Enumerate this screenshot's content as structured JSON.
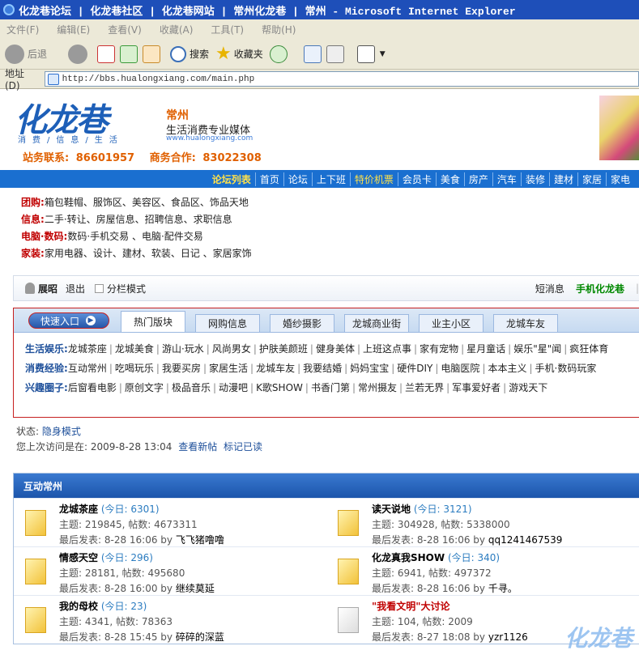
{
  "window": {
    "title": "化龙巷论坛 | 化龙巷社区 | 化龙巷网站 | 常州化龙巷 | 常州 - Microsoft Internet Explorer"
  },
  "menubar": [
    "文件(F)",
    "编辑(E)",
    "查看(V)",
    "收藏(A)",
    "工具(T)",
    "帮助(H)"
  ],
  "toolbar": {
    "back": "后退",
    "search": "搜索",
    "favorites": "收藏夹"
  },
  "address": {
    "label": "地址(D)",
    "url": "http://bbs.hualongxiang.com/main.php"
  },
  "header": {
    "logo": "化龙巷",
    "logo_sub": "消费/信息/生活",
    "city": "常州",
    "slogan": "生活消费专业媒体",
    "site": "www.hualongxiang.com",
    "contact_label": "站务联系:",
    "contact_phone": "86601957",
    "biz_label": "商务合作:",
    "biz_phone": "83022308"
  },
  "nav": [
    "论坛列表",
    "首页",
    "论坛",
    "上下班",
    "特价机票",
    "会员卡",
    "美食",
    "房产",
    "汽车",
    "装修",
    "建材",
    "家居",
    "家电"
  ],
  "categories": [
    {
      "label": "团购:",
      "items": "箱包鞋帽、服饰区、美容区、食品区、饰品天地"
    },
    {
      "label": "信息:",
      "items": "二手·转让、房屋信息、招聘信息、求职信息"
    },
    {
      "label": "电脑·数码:",
      "items": "数码·手机交易 、电脑·配件交易"
    },
    {
      "label": "家装:",
      "items": "家用电器、设计、建材、软装、日记 、家居家饰"
    }
  ],
  "userbar": {
    "user": "展昭",
    "logout": "退出",
    "split_mode": "分栏模式",
    "messages": "短消息",
    "phone": "手机化龙巷"
  },
  "quick": {
    "button": "快速入口",
    "tabs": [
      "热门版块",
      "网购信息",
      "婚纱摄影",
      "龙城商业街",
      "业主小区",
      "龙城车友"
    ],
    "rows": [
      {
        "label": "生活娱乐:",
        "items": [
          "龙城茶座",
          "龙城美食",
          "游山·玩水",
          "风尚男女",
          "护肤美颜班",
          "健身美体",
          "上班这点事",
          "家有宠物",
          "星月童话",
          "娱乐\"星\"闻",
          "疯狂体育"
        ]
      },
      {
        "label": "消费经验:",
        "items": [
          "互动常州",
          "吃喝玩乐",
          "我要买房",
          "家居生活",
          "龙城车友",
          "我要结婚",
          "妈妈宝宝",
          "硬件DIY",
          "电脑医院",
          "本本主义",
          "手机·数码玩家"
        ]
      },
      {
        "label": "兴趣圈子:",
        "items": [
          "后窗看电影",
          "原创文字",
          "极品音乐",
          "动漫吧",
          "K歌SHOW",
          "书香门第",
          "常州摄友",
          "兰若无界",
          "军事爱好者",
          "游戏天下"
        ]
      }
    ]
  },
  "status": {
    "label": "状态:",
    "mode": "隐身模式",
    "last_visit_label": "您上次访问是在:",
    "last_visit": "2009-8-28 13:04",
    "new_posts": "查看新帖",
    "mark_read": "标记已读"
  },
  "forum": {
    "title": "互动常州",
    "rows": [
      [
        {
          "name": "龙城茶座",
          "today": "(今日: 6301)",
          "stats": "主题: 219845, 帖数: 4673311",
          "last": "最后发表: 8-28 16:06 by",
          "by": "飞飞猪噜噜"
        },
        {
          "name": "读天说地",
          "today": "(今日: 3121)",
          "stats": "主题: 304928, 帖数: 5338000",
          "last": "最后发表: 8-28 16:06 by",
          "by": "qq1241467539"
        }
      ],
      [
        {
          "name": "情感天空",
          "today": "(今日: 296)",
          "stats": "主题: 28181, 帖数: 495680",
          "last": "最后发表: 8-28 16:00 by",
          "by": "继续莫延"
        },
        {
          "name": "化龙真我SHOW",
          "today": "(今日: 340)",
          "stats": "主题: 6941, 帖数: 497372",
          "last": "最后发表: 8-28 16:06 by",
          "by": "千寻。"
        }
      ],
      [
        {
          "name": "我的母校",
          "today": "(今日: 23)",
          "stats": "主题: 4341, 帖数: 78363",
          "last": "最后发表: 8-28 15:45 by",
          "by": "碎碎的深蓝"
        },
        {
          "name": "\"我看文明\"大讨论",
          "today": "",
          "stats": "主题: 104, 帖数: 2009",
          "last": "最后发表: 8-27 18:08 by",
          "by": "yzr1126"
        }
      ]
    ]
  },
  "watermark": "化龙巷"
}
